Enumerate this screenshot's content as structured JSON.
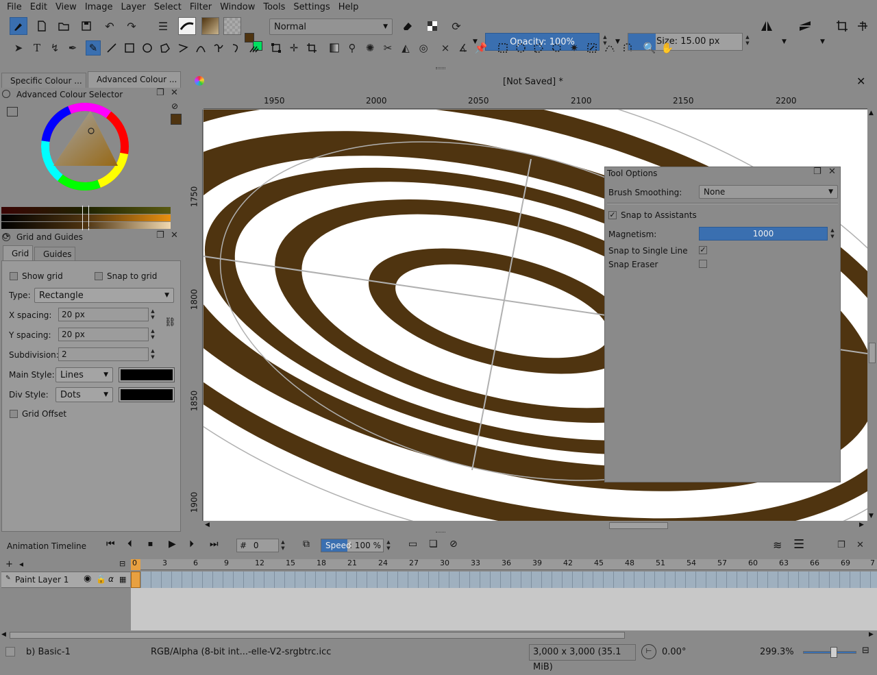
{
  "menu": [
    "File",
    "Edit",
    "View",
    "Image",
    "Layer",
    "Select",
    "Filter",
    "Window",
    "Tools",
    "Settings",
    "Help"
  ],
  "toolbar": {
    "blend_mode": "Normal",
    "opacity": "Opacity: 100%",
    "size": "Size: 15.00 px"
  },
  "panels": {
    "tabs": [
      "Specific Colour ...",
      "Advanced Colour ..."
    ],
    "colour_selector_title": "Advanced Colour Selector",
    "grid_title": "Grid and Guides",
    "grid_tabs": [
      "Grid",
      "Guides"
    ],
    "show_grid": "Show grid",
    "snap_to_grid": "Snap to grid",
    "type_label": "Type:",
    "type_value": "Rectangle",
    "x_spacing_label": "X spacing:",
    "x_spacing": "20 px",
    "y_spacing_label": "Y spacing:",
    "y_spacing": "20 px",
    "subdivision_label": "Subdivision:",
    "subdivision": "2",
    "main_style_label": "Main Style:",
    "main_style": "Lines",
    "div_style_label": "Div Style:",
    "div_style": "Dots",
    "grid_offset": "Grid Offset"
  },
  "document": {
    "title": "[Not Saved]  *",
    "ruler_h": [
      "1950",
      "2000",
      "2050",
      "2100",
      "2150",
      "2200"
    ],
    "ruler_v": [
      "1750",
      "1800",
      "1850",
      "1900"
    ]
  },
  "tool_options": {
    "title": "Tool Options",
    "brush_smoothing_label": "Brush Smoothing:",
    "brush_smoothing": "None",
    "snap_to_assistants": "Snap to Assistants",
    "magnetism_label": "Magnetism:",
    "magnetism": "1000",
    "snap_single_line": "Snap to Single Line",
    "snap_eraser": "Snap Eraser"
  },
  "timeline": {
    "title": "Animation Timeline",
    "frame": "0",
    "speed_label": "Speed",
    "speed_value": ": 100 %",
    "frame_hash": "#",
    "layer_name": "Paint Layer 1",
    "frame_numbers": [
      "0",
      "3",
      "6",
      "9",
      "12",
      "15",
      "18",
      "21",
      "24",
      "27",
      "30",
      "33",
      "36",
      "39",
      "42",
      "45",
      "48",
      "51",
      "54",
      "57",
      "60",
      "63",
      "66",
      "69",
      "7"
    ]
  },
  "status": {
    "brush_preset": "b) Basic-1",
    "color_profile": "RGB/Alpha (8-bit int...-elle-V2-srgbtrc.icc",
    "dimensions": "3,000 x 3,000 (35.1 MiB)",
    "rotation": "0.00°",
    "zoom": "299.3%"
  },
  "colors": {
    "foreground": "#4f3410",
    "background": "#00e060",
    "accent": "#3a6fb0",
    "ring_brown": "#4f3410"
  }
}
